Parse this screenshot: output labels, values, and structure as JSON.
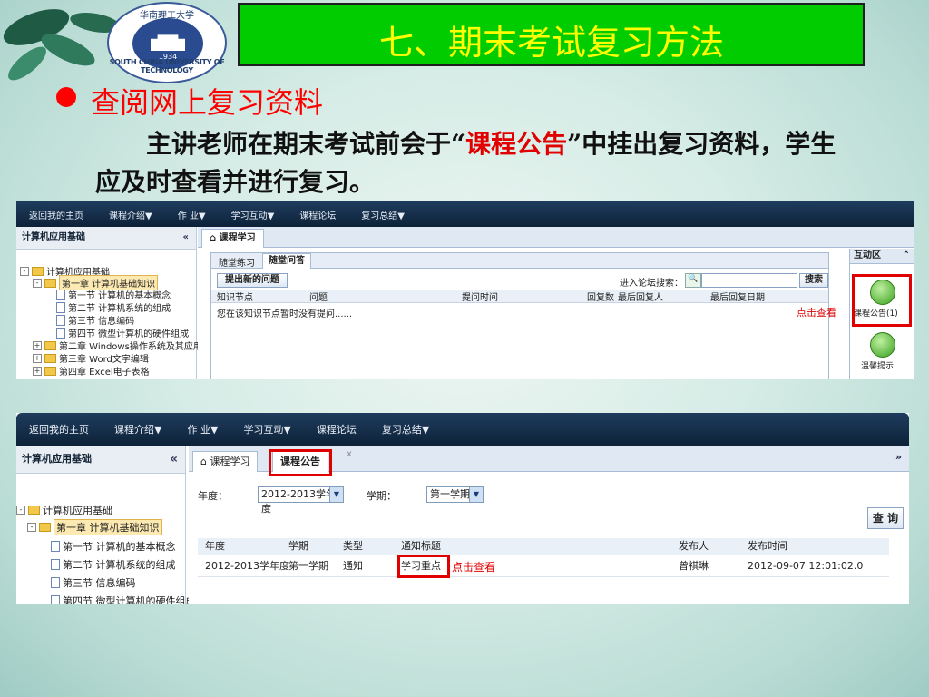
{
  "slide": {
    "title": "七、期末考试复习方法",
    "bullet": "查阅网上复习资料",
    "para_before": "主讲老师在期末考试前会于“",
    "para_highlight": "课程公告",
    "para_after": "”中挂出复习资料，学生应及时查看并进行复习。",
    "colors": {
      "title_bg": "#00cc00",
      "title_text": "#ffff00",
      "bullet": "#ff0000",
      "highlight": "#e00000"
    }
  },
  "logo": {
    "name_cn": "华南理工大学",
    "name_en": "SOUTH CHINA UNIVERSITY OF TECHNOLOGY",
    "year": "1934"
  },
  "nav": [
    "返回我的主页",
    "课程介绍▼",
    "作 业▼",
    "学习互动▼",
    "课程论坛",
    "复习总结▼"
  ],
  "sidebar": {
    "title": "计算机应用基础",
    "collapse": "«",
    "tree": [
      "计算机应用基础",
      "第一章 计算机基础知识",
      "第一节 计算机的基本概念",
      "第二节 计算机系统的组成",
      "第三节 信息编码",
      "第四节 微型计算机的硬件组成",
      "第二章 Windows操作系统及其应用",
      "第三章 Word文字编辑",
      "第四章 Excel电子表格"
    ]
  },
  "shot1": {
    "tab_main": "课程学习",
    "subtabs": [
      "随堂练习",
      "随堂问答"
    ],
    "new_question": "提出新的问题",
    "search_label": "进入论坛搜索：",
    "search_button": "搜索",
    "columns": [
      "知识节点",
      "问题",
      "提问时间",
      "回复数",
      "最后回复人",
      "最后回复日期"
    ],
    "empty_msg": "您在该知识节点暂时没有提问......",
    "interact_title": "互动区",
    "interact_items": [
      "课程公告(1)",
      "温馨提示"
    ],
    "annotation": "点击查看"
  },
  "shot2": {
    "tabs": [
      "课程学习",
      "课程公告"
    ],
    "tab_close": "x",
    "year_label": "年度：",
    "year_value": "2012-2013学年度",
    "term_label": "学期：",
    "term_value": "第一学期",
    "query_button": "查 询",
    "columns": [
      "年度",
      "学期",
      "类型",
      "通知标题",
      "发布人",
      "发布时间"
    ],
    "row": [
      "2012-2013学年度",
      "第一学期",
      "通知",
      "学习重点",
      "曾祺琳",
      "2012-09-07 12:01:02.0"
    ],
    "annotation": "点击查看"
  }
}
